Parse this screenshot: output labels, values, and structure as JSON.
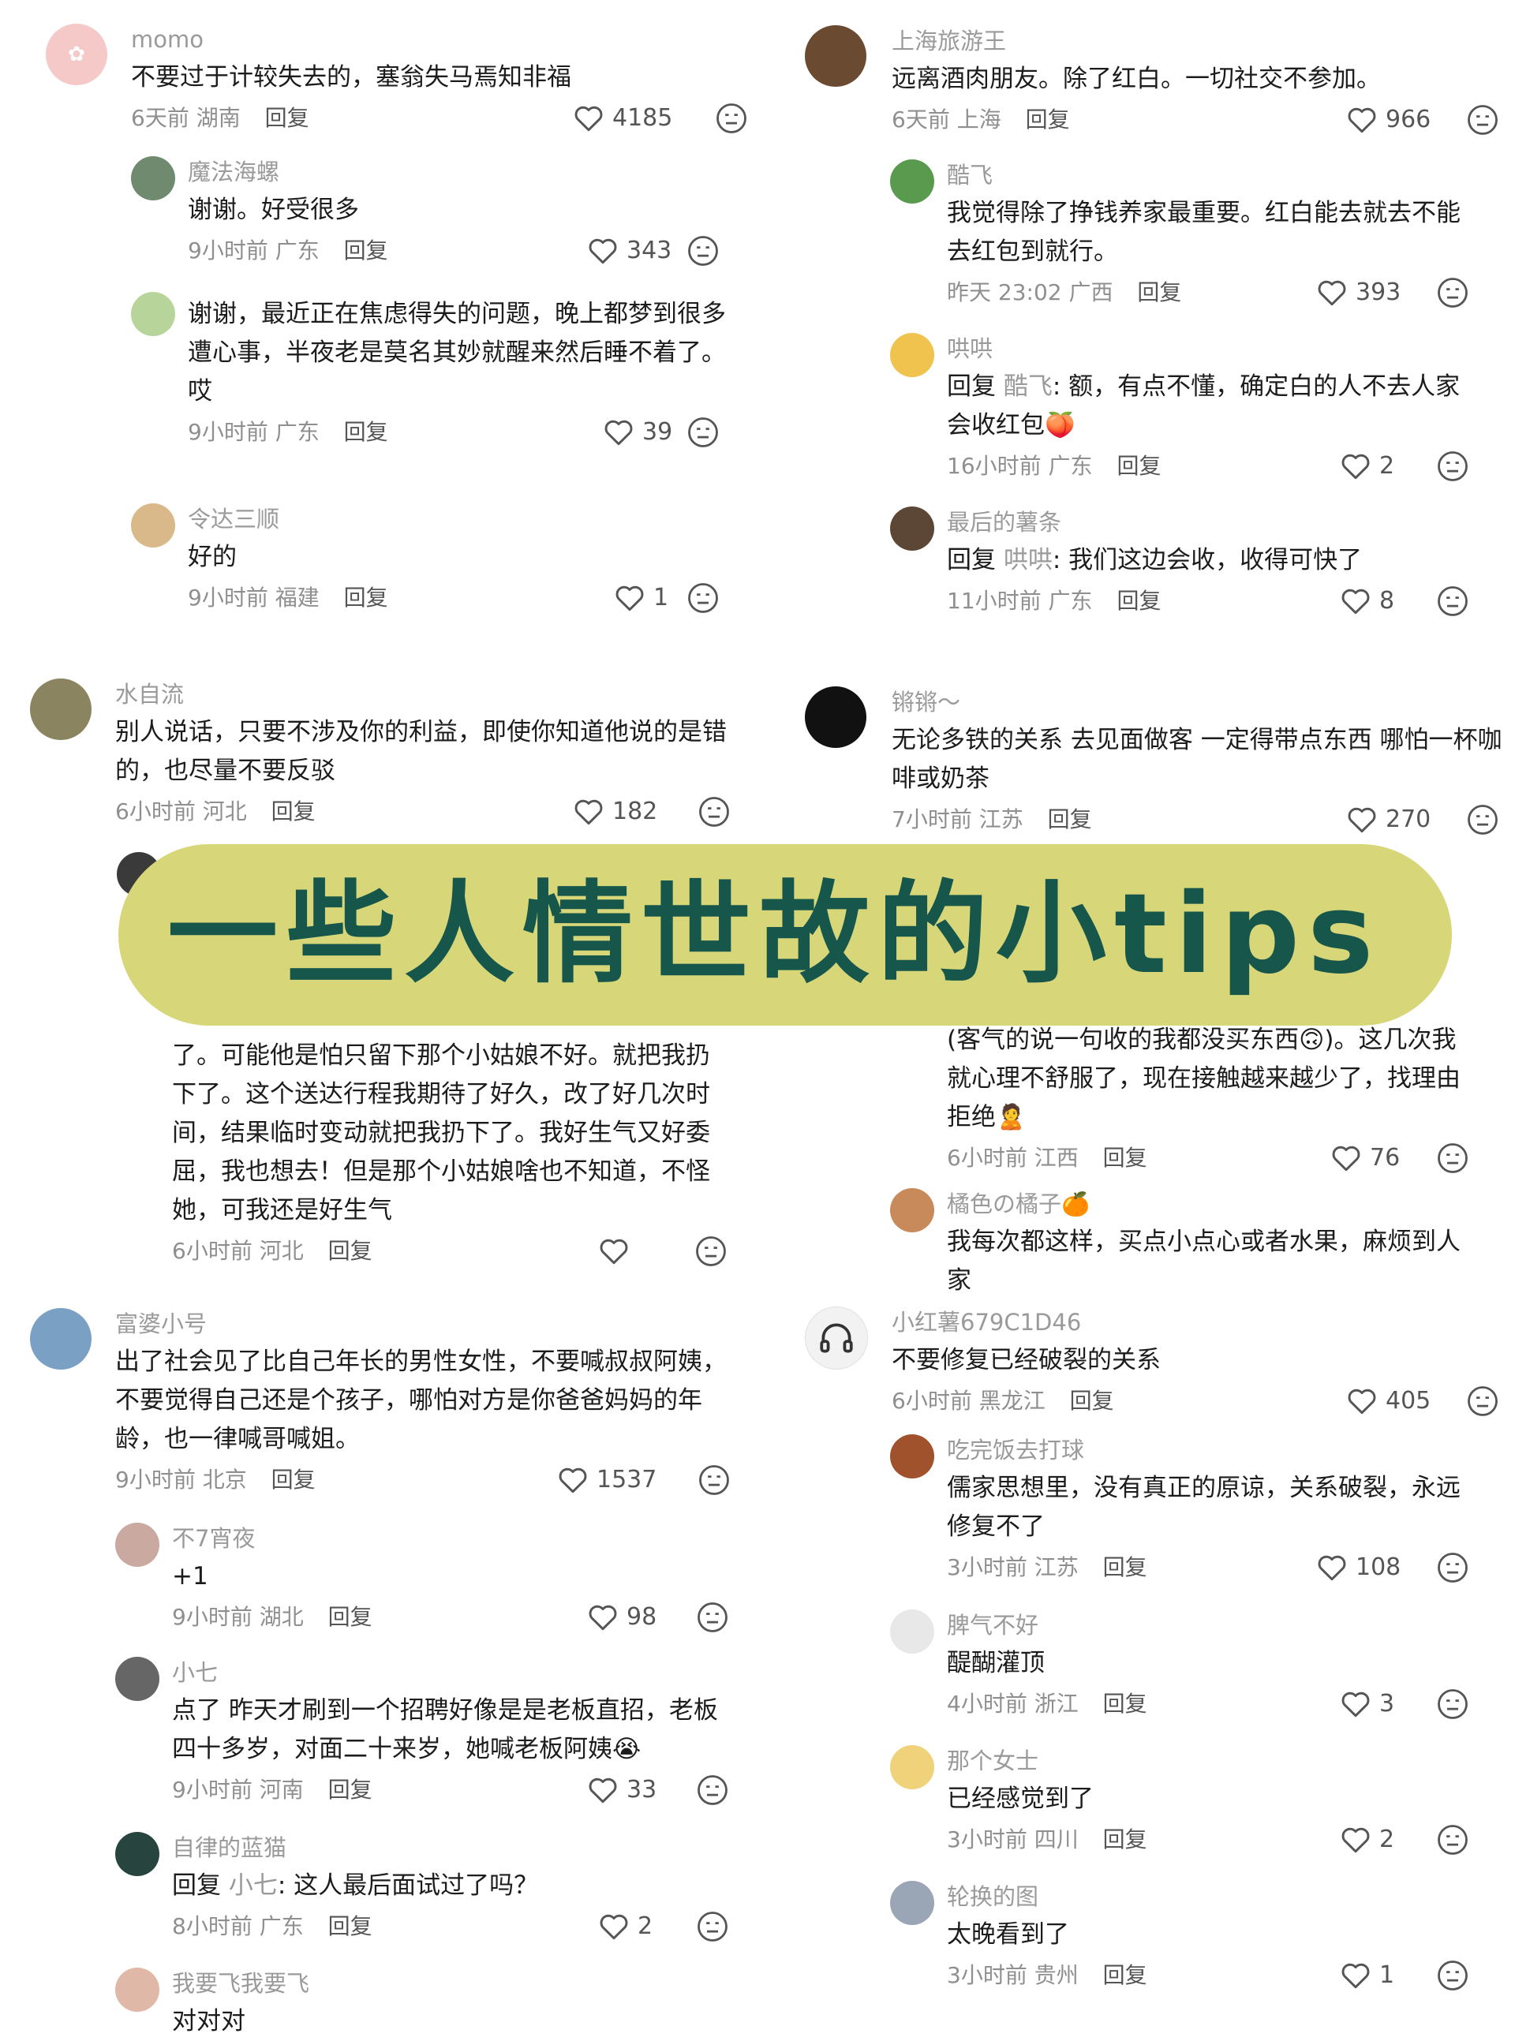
{
  "banner": {
    "title": "一些人情世故的小tips"
  },
  "ui": {
    "reply_label": "回复"
  },
  "left": [
    {
      "user": "momo",
      "text": "不要过于计较失去的，塞翁失马焉知非福",
      "time": "6天前",
      "region": "湖南",
      "likes": "4185",
      "replies": [
        {
          "user": "魔法海螺",
          "text": "谢谢。好受很多",
          "time": "9小时前",
          "region": "广东",
          "likes": "343"
        },
        {
          "user": "",
          "text": "谢谢，最近正在焦虑得失的问题，晚上都梦到很多遭心事，半夜老是莫名其妙就醒来然后睡不着了。哎",
          "time": "9小时前",
          "region": "广东",
          "likes": "39"
        },
        {
          "user": "令达三顺",
          "text": "好的",
          "time": "9小时前",
          "region": "福建",
          "likes": "1"
        }
      ]
    },
    {
      "user": "水自流",
      "text": "别人说话，只要不涉及你的利益，即使你知道他说的是错的，也尽量不要反驳",
      "time": "6小时前",
      "region": "河北",
      "likes": "182",
      "replies": [
        {
          "user": "",
          "text": "了。可能他是怕只留下那个小姑娘不好。就把我扔下了。这个送达行程我期待了好久，改了好几次时间，结果临时变动就把我扔下了。我好生气又好委屈，我也想去！但是那个小姑娘啥也不知道，不怪她，可我还是好生气",
          "time": "6小时前",
          "region": "河北",
          "likes": ""
        }
      ]
    },
    {
      "user": "富婆小号",
      "text": "出了社会见了比自己年长的男性女性，不要喊叔叔阿姨，不要觉得自己还是个孩子，哪怕对方是你爸爸妈妈的年龄，也一律喊哥喊姐。",
      "time": "9小时前",
      "region": "北京",
      "likes": "1537",
      "replies": [
        {
          "user": "不7宵夜",
          "text": "+1",
          "time": "9小时前",
          "region": "湖北",
          "likes": "98"
        },
        {
          "user": "小七",
          "text": "点了 昨天才刷到一个招聘好像是是老板直招，老板四十多岁，对面二十来岁，她喊老板阿姨😭",
          "time": "9小时前",
          "region": "河南",
          "likes": "33"
        },
        {
          "user": "自律的蓝猫",
          "reply_to": "小七",
          "text": "这人最后面试过了吗？",
          "time": "8小时前",
          "region": "广东",
          "likes": "2"
        },
        {
          "user": "我要飞我要飞",
          "text": "对对对",
          "time": "",
          "region": "",
          "likes": ""
        }
      ]
    }
  ],
  "right": [
    {
      "user": "上海旅游王",
      "text": "远离酒肉朋友。除了红白。一切社交不参加。",
      "time": "6天前",
      "region": "上海",
      "likes": "966",
      "replies": [
        {
          "user": "酷飞",
          "text": "我觉得除了挣钱养家最重要。红白能去就去不能去红包到就行。",
          "time": "昨天 23:02",
          "region": "广西",
          "likes": "393"
        },
        {
          "user": "哄哄",
          "reply_to": "酷飞",
          "text": "额，有点不懂，确定白的人不去人家会收红包🍑",
          "time": "16小时前",
          "region": "广东",
          "likes": "2"
        },
        {
          "user": "最后的薯条",
          "reply_to": "哄哄",
          "text": "我们这边会收，收得可快了",
          "time": "11小时前",
          "region": "广东",
          "likes": "8"
        }
      ]
    },
    {
      "user": "锵锵～",
      "text": "无论多铁的关系 去见面做客 一定得带点东西 哪怕一杯咖啡或奶茶",
      "time": "7小时前",
      "region": "江苏",
      "likes": "270",
      "replies": [
        {
          "user": "",
          "text": "(客气的说一句收的我都没买东西🙃)。这几次我就心理不舒服了，现在接触越来越少了，找理由拒绝🙎",
          "time": "6小时前",
          "region": "江西",
          "likes": "76"
        },
        {
          "user": "橘色の橘子🍊",
          "text": "我每次都这样，买点小点心或者水果，麻烦到人家",
          "time": "",
          "region": "",
          "likes": ""
        }
      ]
    },
    {
      "user": "小红薯679C1D46",
      "text": "不要修复已经破裂的关系",
      "time": "6小时前",
      "region": "黑龙江",
      "likes": "405",
      "replies": [
        {
          "user": "吃完饭去打球",
          "text": "儒家思想里，没有真正的原谅，关系破裂，永远修复不了",
          "time": "3小时前",
          "region": "江苏",
          "likes": "108"
        },
        {
          "user": "脾气不好",
          "text": "醍醐灌顶",
          "time": "4小时前",
          "region": "浙江",
          "likes": "3"
        },
        {
          "user": "那个女士",
          "text": "已经感觉到了",
          "time": "3小时前",
          "region": "四川",
          "likes": "2"
        },
        {
          "user": "轮换的图",
          "text": "太晚看到了",
          "time": "3小时前",
          "region": "贵州",
          "likes": "1"
        }
      ]
    }
  ]
}
